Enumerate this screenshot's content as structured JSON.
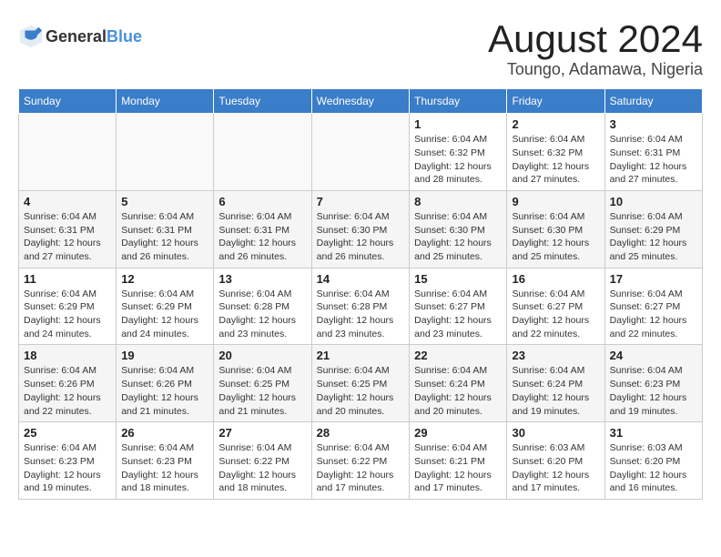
{
  "header": {
    "logo_general": "General",
    "logo_blue": "Blue",
    "month_year": "August 2024",
    "location": "Toungo, Adamawa, Nigeria"
  },
  "calendar": {
    "days_of_week": [
      "Sunday",
      "Monday",
      "Tuesday",
      "Wednesday",
      "Thursday",
      "Friday",
      "Saturday"
    ],
    "weeks": [
      [
        {
          "day": "",
          "info": ""
        },
        {
          "day": "",
          "info": ""
        },
        {
          "day": "",
          "info": ""
        },
        {
          "day": "",
          "info": ""
        },
        {
          "day": "1",
          "info": "Sunrise: 6:04 AM\nSunset: 6:32 PM\nDaylight: 12 hours\nand 28 minutes."
        },
        {
          "day": "2",
          "info": "Sunrise: 6:04 AM\nSunset: 6:32 PM\nDaylight: 12 hours\nand 27 minutes."
        },
        {
          "day": "3",
          "info": "Sunrise: 6:04 AM\nSunset: 6:31 PM\nDaylight: 12 hours\nand 27 minutes."
        }
      ],
      [
        {
          "day": "4",
          "info": "Sunrise: 6:04 AM\nSunset: 6:31 PM\nDaylight: 12 hours\nand 27 minutes."
        },
        {
          "day": "5",
          "info": "Sunrise: 6:04 AM\nSunset: 6:31 PM\nDaylight: 12 hours\nand 26 minutes."
        },
        {
          "day": "6",
          "info": "Sunrise: 6:04 AM\nSunset: 6:31 PM\nDaylight: 12 hours\nand 26 minutes."
        },
        {
          "day": "7",
          "info": "Sunrise: 6:04 AM\nSunset: 6:30 PM\nDaylight: 12 hours\nand 26 minutes."
        },
        {
          "day": "8",
          "info": "Sunrise: 6:04 AM\nSunset: 6:30 PM\nDaylight: 12 hours\nand 25 minutes."
        },
        {
          "day": "9",
          "info": "Sunrise: 6:04 AM\nSunset: 6:30 PM\nDaylight: 12 hours\nand 25 minutes."
        },
        {
          "day": "10",
          "info": "Sunrise: 6:04 AM\nSunset: 6:29 PM\nDaylight: 12 hours\nand 25 minutes."
        }
      ],
      [
        {
          "day": "11",
          "info": "Sunrise: 6:04 AM\nSunset: 6:29 PM\nDaylight: 12 hours\nand 24 minutes."
        },
        {
          "day": "12",
          "info": "Sunrise: 6:04 AM\nSunset: 6:29 PM\nDaylight: 12 hours\nand 24 minutes."
        },
        {
          "day": "13",
          "info": "Sunrise: 6:04 AM\nSunset: 6:28 PM\nDaylight: 12 hours\nand 23 minutes."
        },
        {
          "day": "14",
          "info": "Sunrise: 6:04 AM\nSunset: 6:28 PM\nDaylight: 12 hours\nand 23 minutes."
        },
        {
          "day": "15",
          "info": "Sunrise: 6:04 AM\nSunset: 6:27 PM\nDaylight: 12 hours\nand 23 minutes."
        },
        {
          "day": "16",
          "info": "Sunrise: 6:04 AM\nSunset: 6:27 PM\nDaylight: 12 hours\nand 22 minutes."
        },
        {
          "day": "17",
          "info": "Sunrise: 6:04 AM\nSunset: 6:27 PM\nDaylight: 12 hours\nand 22 minutes."
        }
      ],
      [
        {
          "day": "18",
          "info": "Sunrise: 6:04 AM\nSunset: 6:26 PM\nDaylight: 12 hours\nand 22 minutes."
        },
        {
          "day": "19",
          "info": "Sunrise: 6:04 AM\nSunset: 6:26 PM\nDaylight: 12 hours\nand 21 minutes."
        },
        {
          "day": "20",
          "info": "Sunrise: 6:04 AM\nSunset: 6:25 PM\nDaylight: 12 hours\nand 21 minutes."
        },
        {
          "day": "21",
          "info": "Sunrise: 6:04 AM\nSunset: 6:25 PM\nDaylight: 12 hours\nand 20 minutes."
        },
        {
          "day": "22",
          "info": "Sunrise: 6:04 AM\nSunset: 6:24 PM\nDaylight: 12 hours\nand 20 minutes."
        },
        {
          "day": "23",
          "info": "Sunrise: 6:04 AM\nSunset: 6:24 PM\nDaylight: 12 hours\nand 19 minutes."
        },
        {
          "day": "24",
          "info": "Sunrise: 6:04 AM\nSunset: 6:23 PM\nDaylight: 12 hours\nand 19 minutes."
        }
      ],
      [
        {
          "day": "25",
          "info": "Sunrise: 6:04 AM\nSunset: 6:23 PM\nDaylight: 12 hours\nand 19 minutes."
        },
        {
          "day": "26",
          "info": "Sunrise: 6:04 AM\nSunset: 6:23 PM\nDaylight: 12 hours\nand 18 minutes."
        },
        {
          "day": "27",
          "info": "Sunrise: 6:04 AM\nSunset: 6:22 PM\nDaylight: 12 hours\nand 18 minutes."
        },
        {
          "day": "28",
          "info": "Sunrise: 6:04 AM\nSunset: 6:22 PM\nDaylight: 12 hours\nand 17 minutes."
        },
        {
          "day": "29",
          "info": "Sunrise: 6:04 AM\nSunset: 6:21 PM\nDaylight: 12 hours\nand 17 minutes."
        },
        {
          "day": "30",
          "info": "Sunrise: 6:03 AM\nSunset: 6:20 PM\nDaylight: 12 hours\nand 17 minutes."
        },
        {
          "day": "31",
          "info": "Sunrise: 6:03 AM\nSunset: 6:20 PM\nDaylight: 12 hours\nand 16 minutes."
        }
      ]
    ]
  }
}
